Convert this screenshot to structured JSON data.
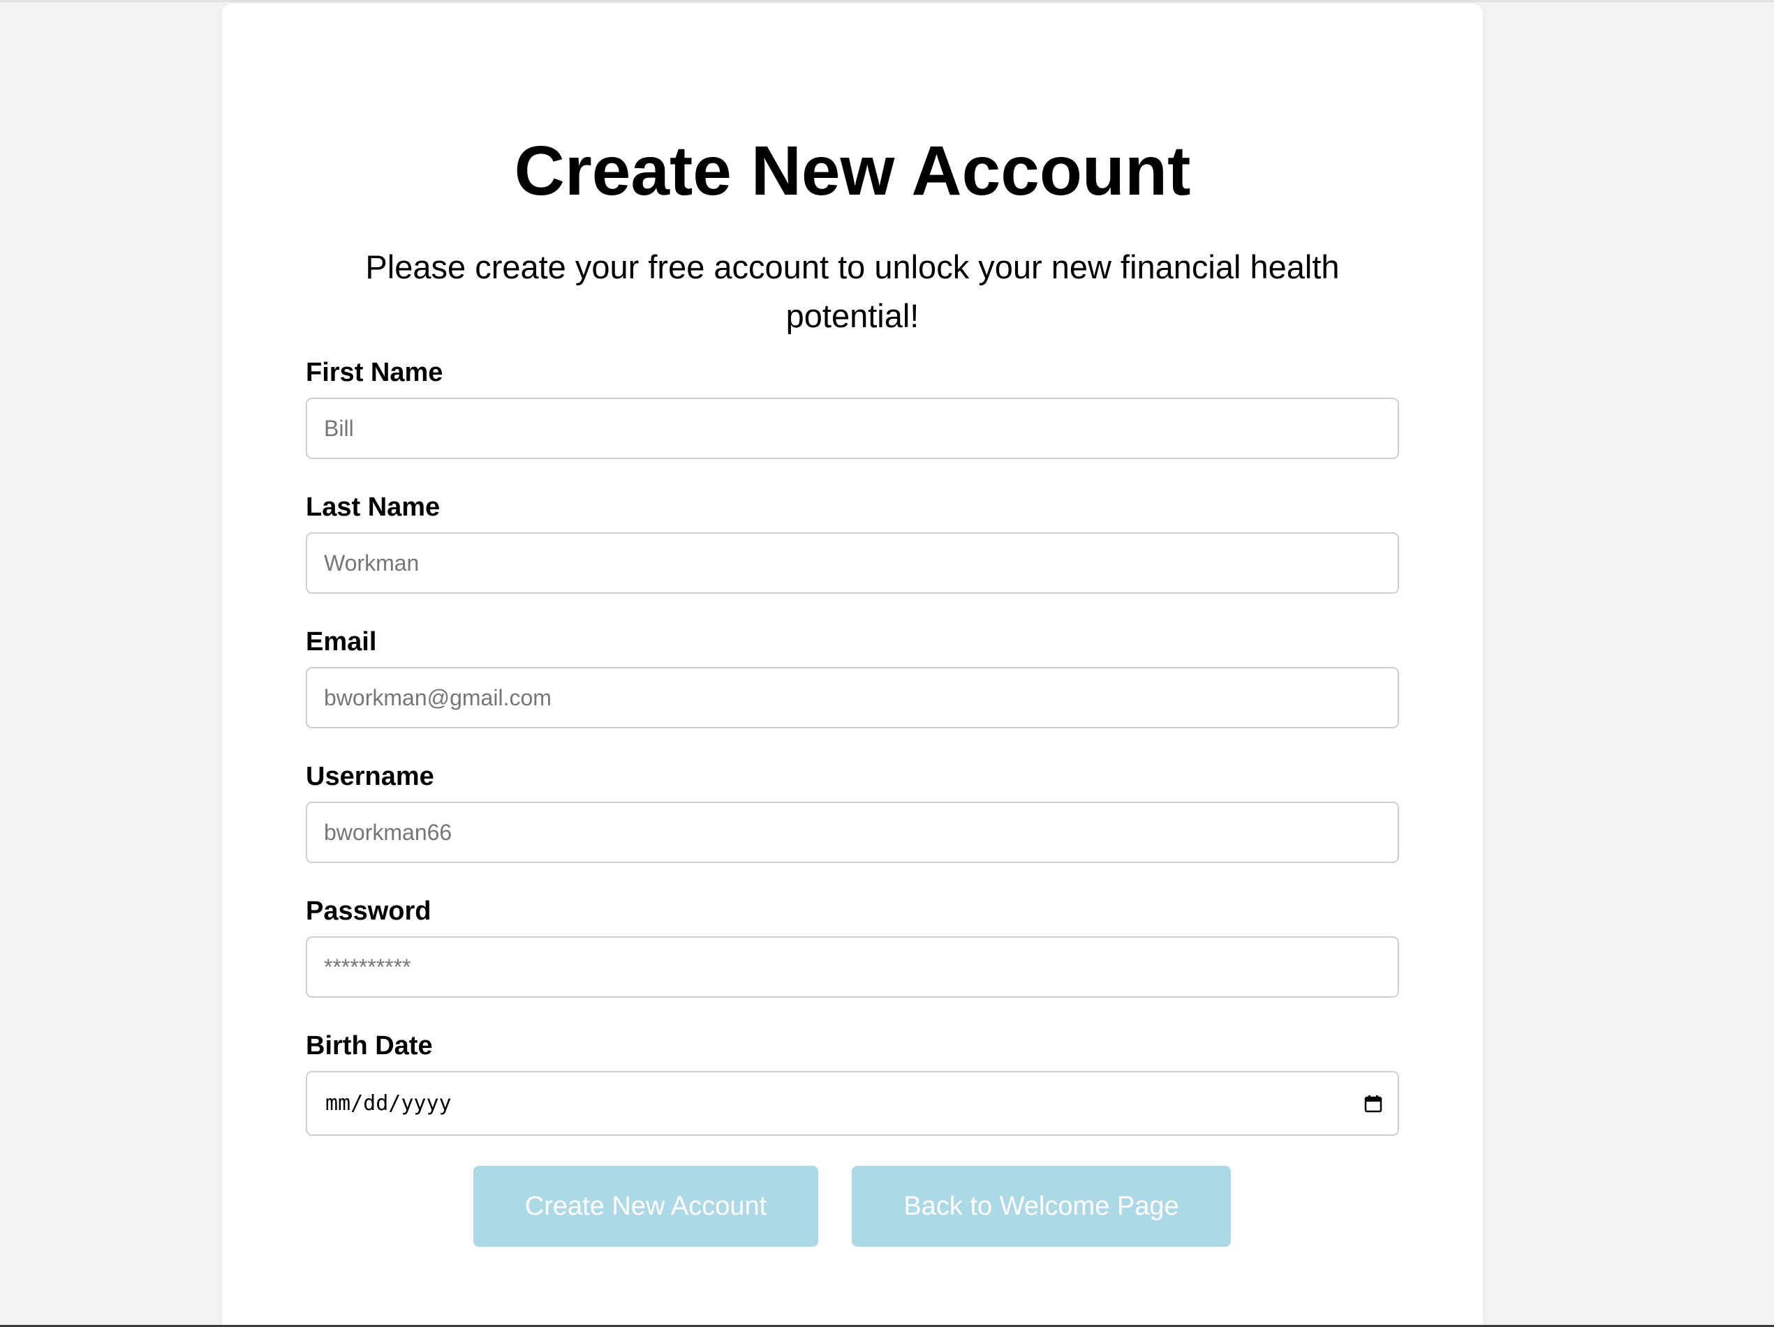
{
  "form": {
    "title": "Create New Account",
    "subtitle": "Please create your free account to unlock your new financial health potential!",
    "fields": [
      {
        "label": "First Name",
        "placeholder": "Bill"
      },
      {
        "label": "Last Name",
        "placeholder": "Workman"
      },
      {
        "label": "Email",
        "placeholder": "bworkman@gmail.com"
      },
      {
        "label": "Username",
        "placeholder": "bworkman66"
      },
      {
        "label": "Password",
        "placeholder": "**********"
      }
    ],
    "birth_date": {
      "label": "Birth Date",
      "format_text": "mm/dd/yyyy",
      "icon": "calendar-icon"
    }
  },
  "actions": {
    "create_label": "Create New Account",
    "back_label": "Back to Welcome Page",
    "button_color": "#add8e6"
  }
}
